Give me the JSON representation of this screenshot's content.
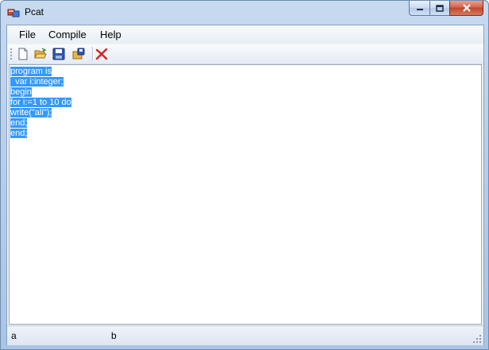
{
  "window": {
    "title": "Pcat",
    "buttons": {
      "minimize": "minimize-icon",
      "maximize": "maximize-icon",
      "close": "close-icon"
    }
  },
  "menu": {
    "items": [
      {
        "label": "File"
      },
      {
        "label": "Compile"
      },
      {
        "label": "Help"
      }
    ]
  },
  "toolbar": {
    "buttons": [
      {
        "icon": "new-file-icon"
      },
      {
        "icon": "open-folder-icon"
      },
      {
        "icon": "save-icon"
      },
      {
        "icon": "save-all-icon"
      },
      {
        "icon": "delete-icon"
      }
    ]
  },
  "editor": {
    "lines": [
      "program is",
      "  var i:integer;",
      "begin",
      "for i:=1 to 10 do",
      "write(\"ali\");",
      "end;",
      "end;"
    ],
    "selection_color": "#3399ff"
  },
  "status": {
    "left": "a",
    "right": "b"
  }
}
